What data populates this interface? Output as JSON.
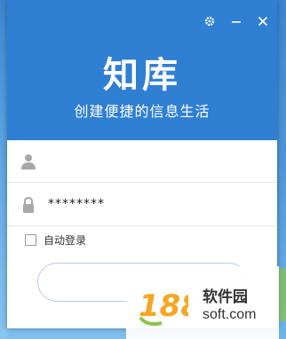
{
  "window": {
    "controls": {
      "settings_icon": "gear-icon",
      "minimize_icon": "minimize-icon",
      "close_icon": "close-icon"
    }
  },
  "brand": {
    "logo_text": "知库",
    "slogan": "创建便捷的信息生活",
    "banner_color": "#2f7fd3"
  },
  "form": {
    "username": {
      "icon": "user-icon",
      "value": ""
    },
    "password": {
      "icon": "lock-icon",
      "value": "********"
    },
    "remember_label": "自动登录",
    "remember_checked": false,
    "login_button": ""
  },
  "watermark": {
    "number": "188",
    "name": "软件园",
    "url": "soft.com"
  }
}
